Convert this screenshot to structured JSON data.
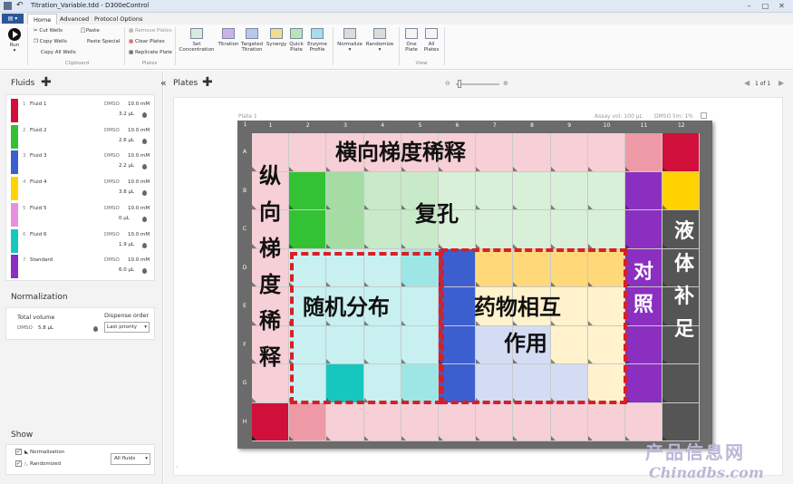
{
  "window": {
    "title": "Titration_Variable.tdd - D300eControl"
  },
  "tabs": [
    {
      "label": "Home"
    },
    {
      "label": "Advanced"
    },
    {
      "label": "Protocol Options"
    }
  ],
  "ribbon": {
    "run": "Run",
    "clipboard": {
      "cut": "Cut Wells",
      "copy": "Copy Wells",
      "copy_all": "Copy All Wells",
      "paste": "Paste",
      "paste_special": "Paste Special",
      "label": "Clipboard"
    },
    "plates": {
      "remove": "Remove Plates",
      "clear": "Clear Plates",
      "replicate": "Replicate Plate",
      "label": "Plates"
    },
    "tools": [
      {
        "label": "Set Concentration"
      },
      {
        "label": "Titration"
      },
      {
        "label": "Targeted Titration"
      },
      {
        "label": "Synergy"
      },
      {
        "label": "Quick Plate"
      },
      {
        "label": "Enzyme Profile"
      }
    ],
    "normalize": "Normalize",
    "randomize": "Randomize",
    "view": {
      "one": "One Plate",
      "all": "All Plates",
      "label": "View"
    }
  },
  "fluids": {
    "title": "Fluids",
    "items": [
      {
        "idx": "1",
        "name": "Fluid 1",
        "solvent": "DMSO",
        "conc": "10.0 mM",
        "vol": "3.2 µL",
        "color": "#d0103a"
      },
      {
        "idx": "2",
        "name": "Fluid 2",
        "solvent": "DMSO",
        "conc": "10.0 mM",
        "vol": "2.6 µL",
        "color": "#33c233"
      },
      {
        "idx": "3",
        "name": "Fluid 3",
        "solvent": "DMSO",
        "conc": "10.0 mM",
        "vol": "2.2 µL",
        "color": "#3c5fd0"
      },
      {
        "idx": "4",
        "name": "Fluid 4",
        "solvent": "DMSO",
        "conc": "10.0 mM",
        "vol": "3.8 µL",
        "color": "#ffd200"
      },
      {
        "idx": "5",
        "name": "Fluid 5",
        "solvent": "DMSO",
        "conc": "10.0 mM",
        "vol": "0 µL",
        "color": "#e890e0"
      },
      {
        "idx": "6",
        "name": "Fluid 6",
        "solvent": "DMSO",
        "conc": "10.0 mM",
        "vol": "1.9 µL",
        "color": "#14c8c0"
      },
      {
        "idx": "7",
        "name": "Standard",
        "solvent": "DMSO",
        "conc": "10.0 mM",
        "vol": "6.0 µL",
        "color": "#8a2fc0"
      }
    ]
  },
  "normalization": {
    "title": "Normalization",
    "total_volume": "Total volume",
    "dispense_order": "Dispense order",
    "solvent": "DMSO",
    "value": "5.8 µL",
    "order_value": "Last priority"
  },
  "show": {
    "title": "Show",
    "normalization": "Normalization",
    "randomized": "Randomized",
    "select": "All fluids"
  },
  "plates_view": {
    "title": "Plates",
    "page": "1 of 1",
    "plate_name": "Plate 1",
    "assay_vol": "Assay vol: 100 µL",
    "dmso_lim": "DMSO lim: 1%"
  },
  "plate": {
    "cols": [
      "1",
      "2",
      "3",
      "4",
      "5",
      "6",
      "7",
      "8",
      "9",
      "10",
      "11",
      "12"
    ],
    "rows": [
      "A",
      "B",
      "C",
      "D",
      "E",
      "F",
      "G",
      "H"
    ]
  },
  "annotations": {
    "horizontal": "横向梯度稀释",
    "replicate": "复孔",
    "vertical": [
      "纵",
      "向",
      "梯",
      "度",
      "稀",
      "释"
    ],
    "random": "随机分布",
    "interaction_1": "药物相互",
    "interaction_2": "作用",
    "control": [
      "对",
      "照"
    ],
    "backfill": [
      "液",
      "体",
      "补",
      "足"
    ]
  },
  "watermark": {
    "cn": "产品信息网",
    "en": "Chinadbs.com"
  }
}
